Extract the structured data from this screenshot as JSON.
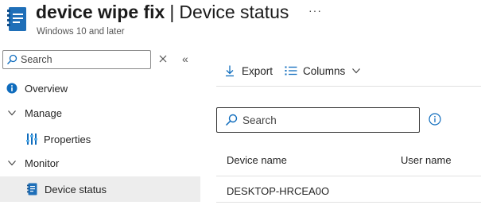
{
  "header": {
    "title_bold": "device wipe fix",
    "separator": "|",
    "title": "Device status",
    "more": "···",
    "subtitle": "Windows 10 and later",
    "icon": "configuration-profile-icon"
  },
  "sidebar": {
    "search": {
      "placeholder": "Search",
      "value": ""
    },
    "items": [
      {
        "label": "Overview",
        "icon": "info-icon",
        "type": "link"
      },
      {
        "label": "Manage",
        "icon": "chevron-down-icon",
        "type": "group"
      },
      {
        "label": "Properties",
        "icon": "properties-icon",
        "type": "link"
      },
      {
        "label": "Monitor",
        "icon": "chevron-down-icon",
        "type": "group"
      },
      {
        "label": "Device status",
        "icon": "device-status-icon",
        "type": "link",
        "selected": true
      }
    ]
  },
  "toolbar": {
    "export_label": "Export",
    "columns_label": "Columns"
  },
  "main": {
    "search": {
      "placeholder": "Search",
      "value": ""
    }
  },
  "table": {
    "columns": [
      "Device name",
      "User name"
    ],
    "rows": [
      [
        "DESKTOP-HRCEA0O",
        ""
      ]
    ]
  },
  "colors": {
    "accent": "#0f6cbd",
    "selected_bg": "#ededed",
    "text": "#242424"
  }
}
